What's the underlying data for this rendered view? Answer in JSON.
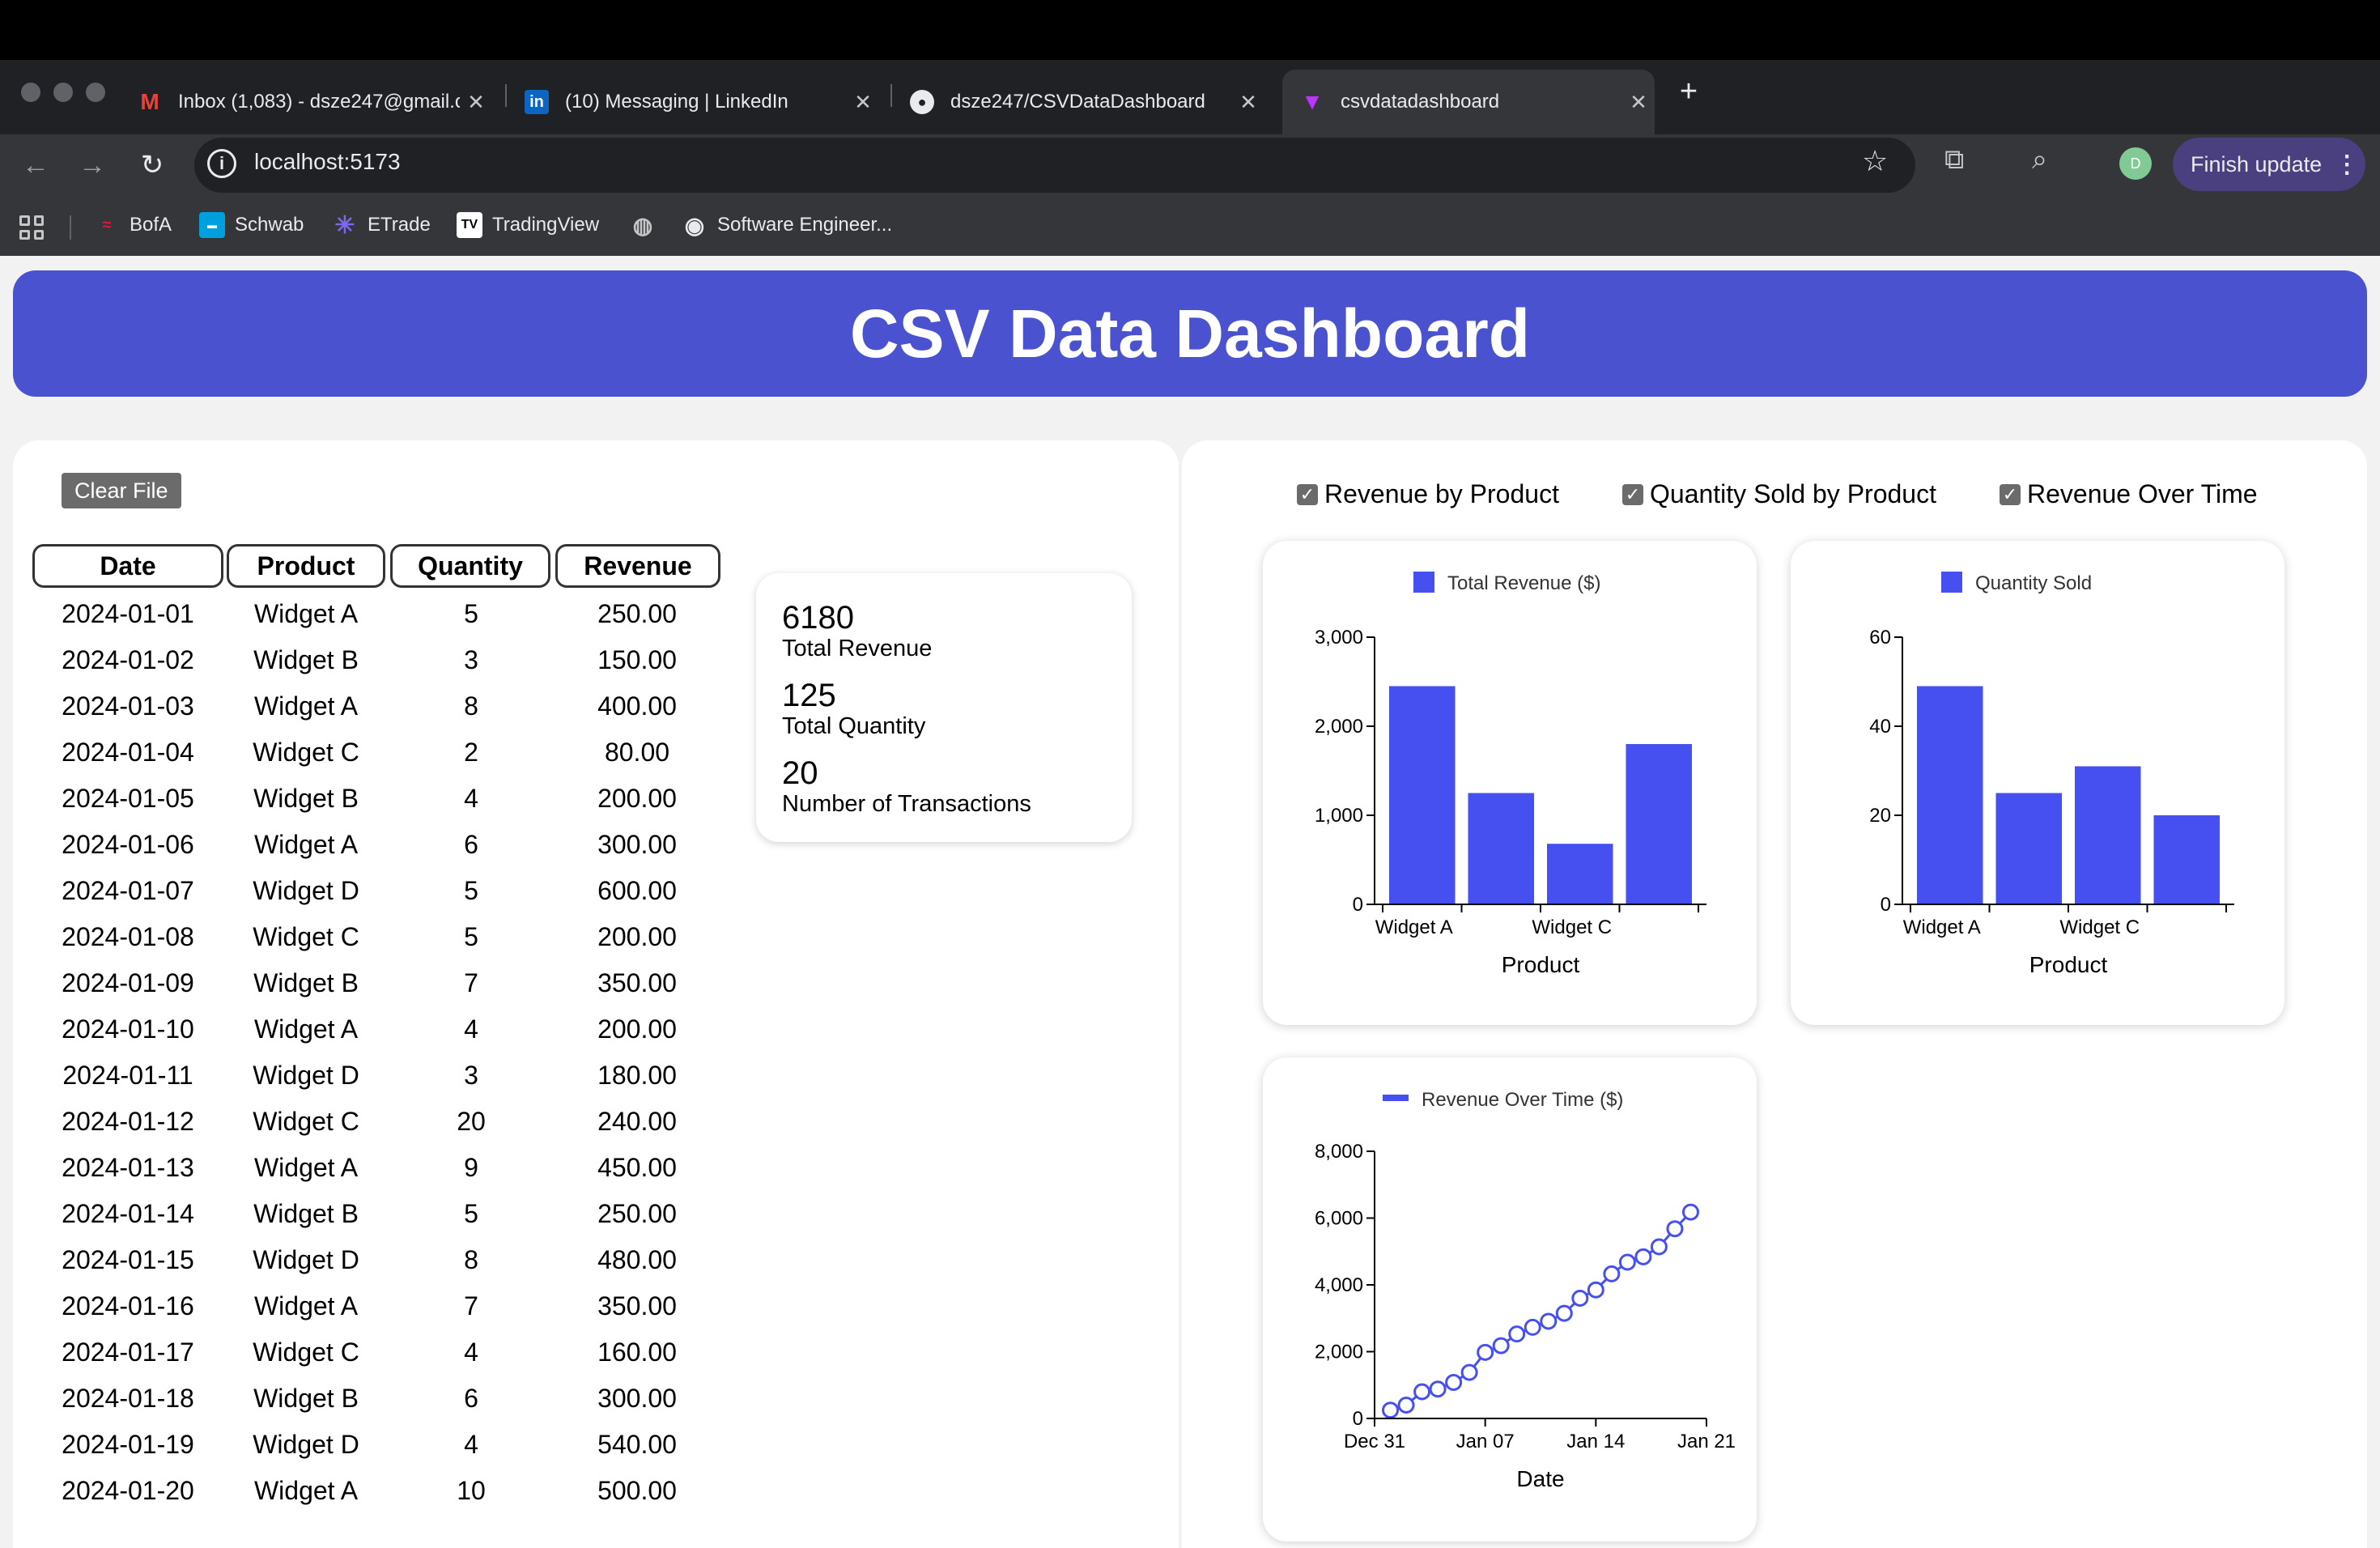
{
  "browser": {
    "tabs": [
      {
        "title": "Inbox (1,083) - dsze247@gmail.com",
        "icon": "gmail-icon",
        "active": false
      },
      {
        "title": "(10) Messaging | LinkedIn",
        "icon": "linkedin-icon",
        "active": false
      },
      {
        "title": "dsze247/CSVDataDashboard",
        "icon": "github-icon",
        "active": false
      },
      {
        "title": "csvdatadashboard",
        "icon": "vite-icon",
        "active": true
      }
    ],
    "url": "localhost:5173",
    "finish_update": "Finish update",
    "profile_initial": "D",
    "bookmarks": [
      "BofA",
      "Schwab",
      "ETrade",
      "TradingView",
      "",
      "Software Engineer..."
    ]
  },
  "page": {
    "title": "CSV Data Dashboard",
    "clear_button": "Clear File",
    "table": {
      "headers": [
        "Date",
        "Product",
        "Quantity",
        "Revenue"
      ],
      "rows": [
        [
          "2024-01-01",
          "Widget A",
          "5",
          "250.00"
        ],
        [
          "2024-01-02",
          "Widget B",
          "3",
          "150.00"
        ],
        [
          "2024-01-03",
          "Widget A",
          "8",
          "400.00"
        ],
        [
          "2024-01-04",
          "Widget C",
          "2",
          "80.00"
        ],
        [
          "2024-01-05",
          "Widget B",
          "4",
          "200.00"
        ],
        [
          "2024-01-06",
          "Widget A",
          "6",
          "300.00"
        ],
        [
          "2024-01-07",
          "Widget D",
          "5",
          "600.00"
        ],
        [
          "2024-01-08",
          "Widget C",
          "5",
          "200.00"
        ],
        [
          "2024-01-09",
          "Widget B",
          "7",
          "350.00"
        ],
        [
          "2024-01-10",
          "Widget A",
          "4",
          "200.00"
        ],
        [
          "2024-01-11",
          "Widget D",
          "3",
          "180.00"
        ],
        [
          "2024-01-12",
          "Widget C",
          "20",
          "240.00"
        ],
        [
          "2024-01-13",
          "Widget A",
          "9",
          "450.00"
        ],
        [
          "2024-01-14",
          "Widget B",
          "5",
          "250.00"
        ],
        [
          "2024-01-15",
          "Widget D",
          "8",
          "480.00"
        ],
        [
          "2024-01-16",
          "Widget A",
          "7",
          "350.00"
        ],
        [
          "2024-01-17",
          "Widget C",
          "4",
          "160.00"
        ],
        [
          "2024-01-18",
          "Widget B",
          "6",
          "300.00"
        ],
        [
          "2024-01-19",
          "Widget D",
          "4",
          "540.00"
        ],
        [
          "2024-01-20",
          "Widget A",
          "10",
          "500.00"
        ]
      ]
    },
    "stats": [
      {
        "value": "6180",
        "label": "Total Revenue"
      },
      {
        "value": "125",
        "label": "Total Quantity"
      },
      {
        "value": "20",
        "label": "Number of Transactions"
      }
    ],
    "toggles": [
      {
        "label": "Revenue by Product",
        "checked": true
      },
      {
        "label": "Quantity Sold by Product",
        "checked": true
      },
      {
        "label": "Revenue Over Time",
        "checked": true
      }
    ]
  },
  "colors": {
    "header": "#4a52cf",
    "series": "#4650f0"
  },
  "chart_data": [
    {
      "type": "bar",
      "legend": "Total Revenue ($)",
      "xlabel": "Product",
      "categories": [
        "Widget A",
        "Widget B",
        "Widget C",
        "Widget D"
      ],
      "x_tick_labels": [
        "Widget A",
        "",
        "Widget C",
        ""
      ],
      "values": [
        2450,
        1250,
        680,
        1800
      ],
      "ylim": [
        0,
        3000
      ],
      "yticks": [
        0,
        1000,
        2000,
        3000
      ],
      "ytick_labels": [
        "0",
        "1,000",
        "2,000",
        "3,000"
      ]
    },
    {
      "type": "bar",
      "legend": "Quantity Sold",
      "xlabel": "Product",
      "categories": [
        "Widget A",
        "Widget B",
        "Widget C",
        "Widget D"
      ],
      "x_tick_labels": [
        "Widget A",
        "",
        "Widget C",
        ""
      ],
      "values": [
        49,
        25,
        31,
        20
      ],
      "ylim": [
        0,
        60
      ],
      "yticks": [
        0,
        20,
        40,
        60
      ],
      "ytick_labels": [
        "0",
        "20",
        "40",
        "60"
      ]
    },
    {
      "type": "line",
      "legend": "Revenue Over Time ($)",
      "xlabel": "Date",
      "x": [
        "2024-01-01",
        "2024-01-02",
        "2024-01-03",
        "2024-01-04",
        "2024-01-05",
        "2024-01-06",
        "2024-01-07",
        "2024-01-08",
        "2024-01-09",
        "2024-01-10",
        "2024-01-11",
        "2024-01-12",
        "2024-01-13",
        "2024-01-14",
        "2024-01-15",
        "2024-01-16",
        "2024-01-17",
        "2024-01-18",
        "2024-01-19",
        "2024-01-20"
      ],
      "y": [
        250,
        400,
        800,
        880,
        1080,
        1380,
        1980,
        2180,
        2530,
        2730,
        2910,
        3150,
        3600,
        3850,
        4330,
        4680,
        4840,
        5140,
        5680,
        6180
      ],
      "xlim": [
        "2023-12-31",
        "2024-01-21"
      ],
      "xticks": [
        "2023-12-31",
        "2024-01-07",
        "2024-01-14",
        "2024-01-21"
      ],
      "xtick_labels": [
        "Dec 31",
        "Jan 07",
        "Jan 14",
        "Jan 21"
      ],
      "ylim": [
        0,
        8000
      ],
      "yticks": [
        0,
        2000,
        4000,
        6000,
        8000
      ],
      "ytick_labels": [
        "0",
        "2,000",
        "4,000",
        "6,000",
        "8,000"
      ]
    }
  ]
}
